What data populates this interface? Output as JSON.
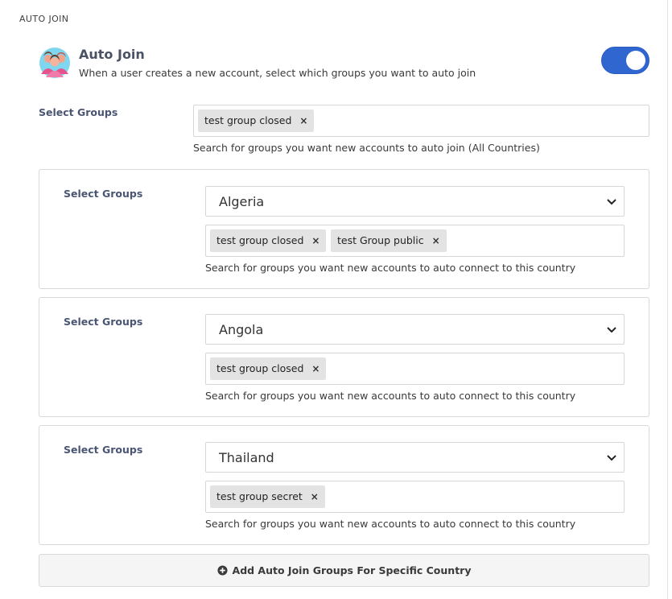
{
  "section": {
    "label": "AUTO JOIN"
  },
  "autojoin": {
    "title": "Auto Join",
    "description": "When a user creates a new account, select which groups you want to auto join",
    "enabled": true,
    "accent_color": "#2f66d0"
  },
  "global_groups": {
    "label": "Select Groups",
    "tags": [
      "test group closed"
    ],
    "help": "Search for groups you want new accounts to auto join (All Countries)"
  },
  "countries": [
    {
      "label": "Select Groups",
      "country": "Algeria",
      "tags": [
        "test group closed",
        "test Group public"
      ],
      "help": "Search for groups you want new accounts to auto connect to this country"
    },
    {
      "label": "Select Groups",
      "country": "Angola",
      "tags": [
        "test group closed"
      ],
      "help": "Search for groups you want new accounts to auto connect to this country"
    },
    {
      "label": "Select Groups",
      "country": "Thailand",
      "tags": [
        "test group secret"
      ],
      "help": "Search for groups you want new accounts to auto connect to this country"
    }
  ],
  "tag_remove_glyph": "×",
  "add_button": {
    "label": "Add Auto Join Groups For Specific Country",
    "icon": "plus-circle-icon"
  }
}
